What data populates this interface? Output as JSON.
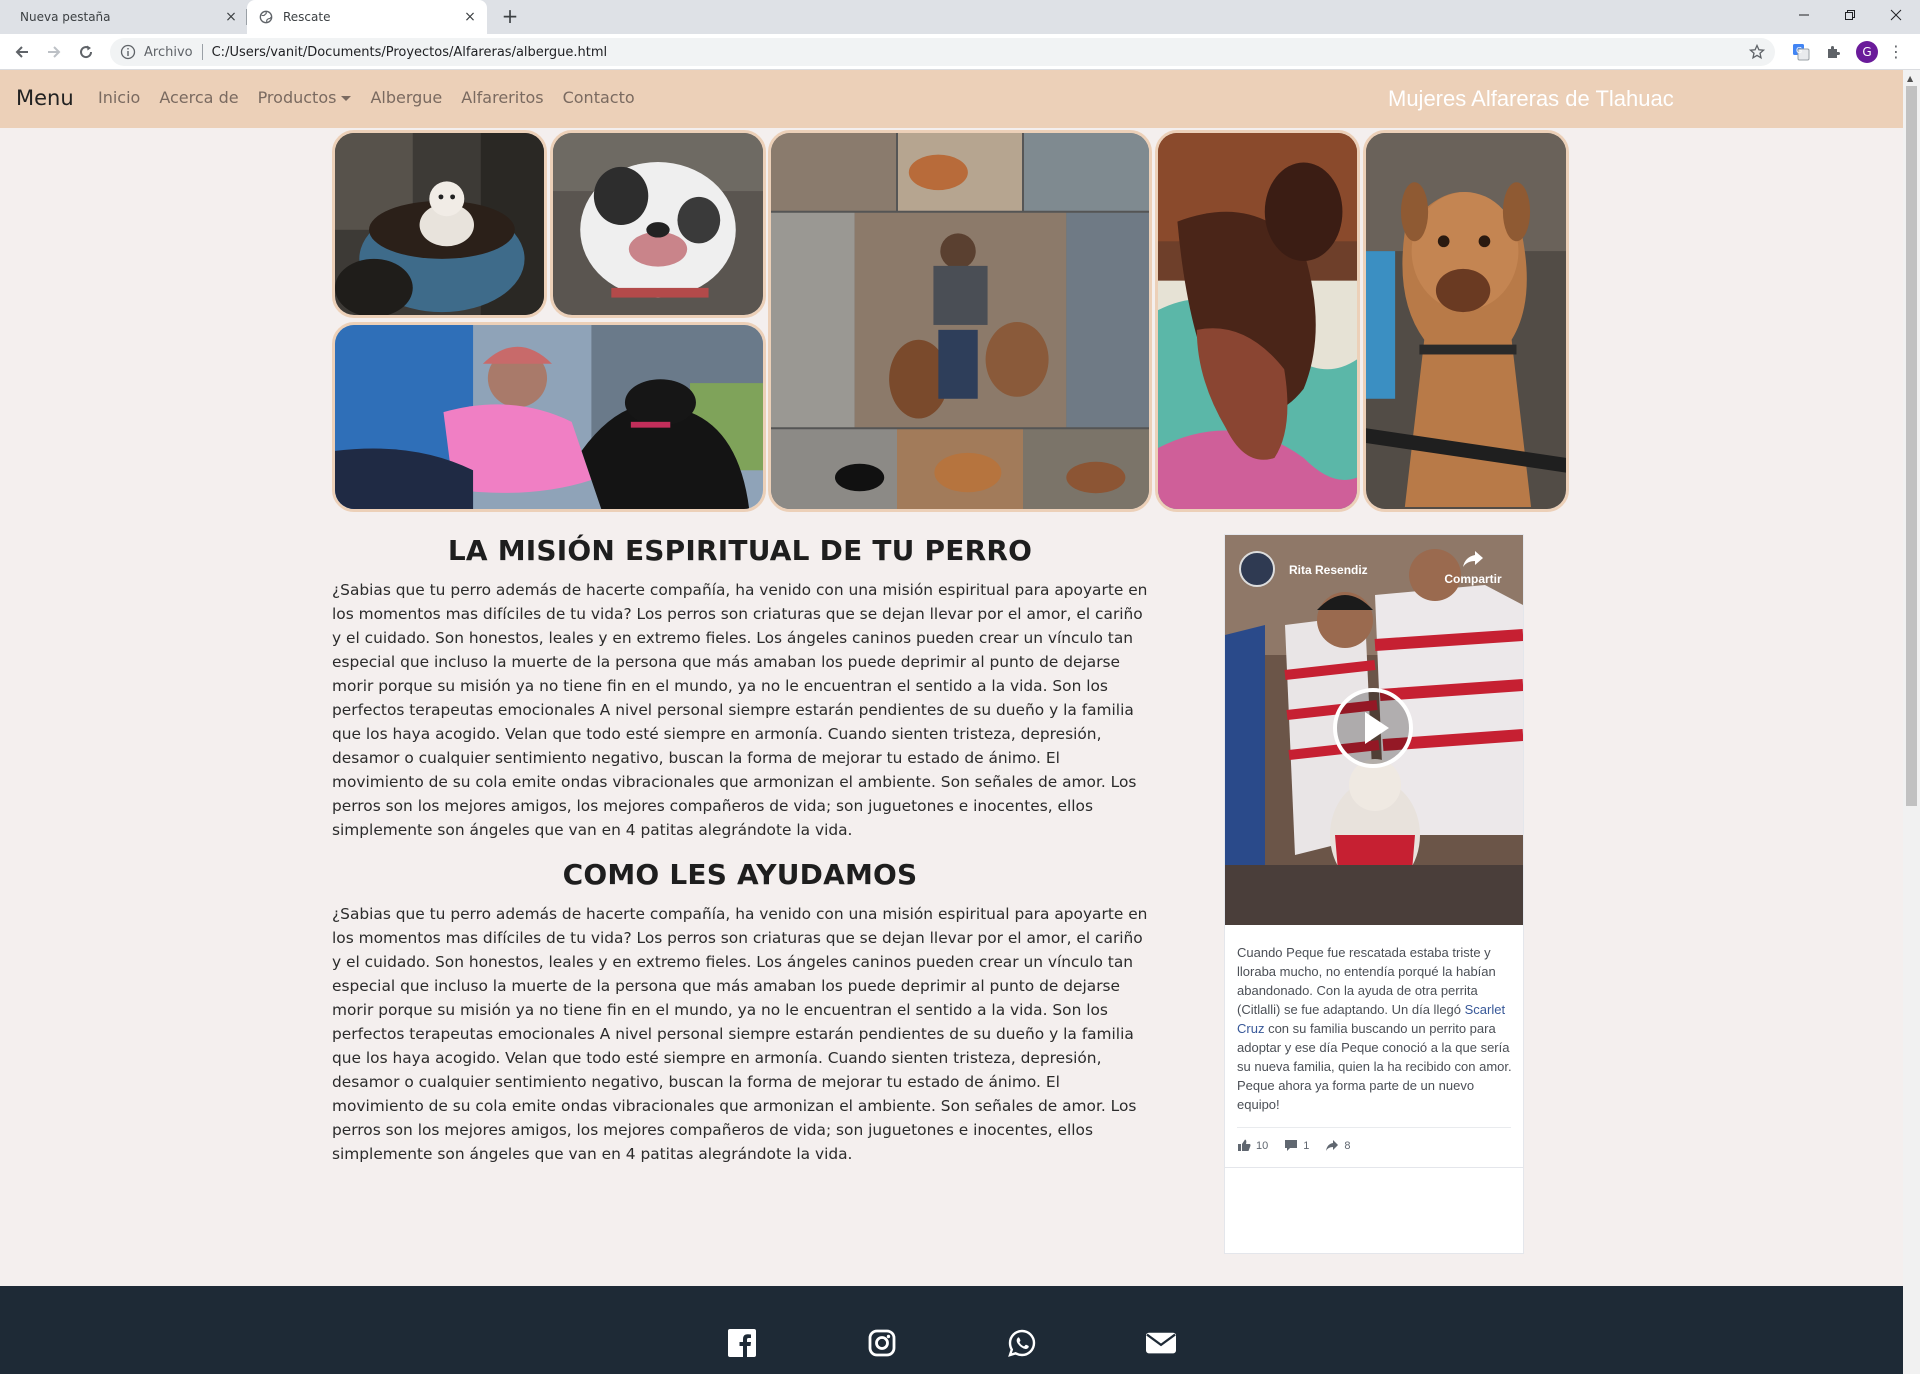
{
  "browser": {
    "tabs": [
      {
        "title": "Nueva pestaña",
        "active": false
      },
      {
        "title": "Rescate",
        "active": true
      }
    ],
    "address": {
      "scheme": "Archivo",
      "url": "C:/Users/vanit/Documents/Proyectos/Alfareras/albergue.html"
    },
    "profile_initial": "G"
  },
  "nav": {
    "brand": "Menu",
    "links": [
      "Inicio",
      "Acerca de",
      "Productos",
      "Albergue",
      "Alfareritos",
      "Contacto"
    ],
    "site_title": "Mujeres Alfareras de Tlahuac"
  },
  "sections": [
    {
      "title": "LA MISIÓN ESPIRITUAL DE TU PERRO",
      "text": "¿Sabias que tu perro además de hacerte compañía, ha venido con una misión espiritual para apoyarte en los momentos mas difíciles de tu vida? Los perros son criaturas que se dejan llevar por el amor, el cariño y el cuidado. Son honestos, leales y en extremo fieles. Los ángeles caninos pueden crear un vínculo tan especial que incluso la muerte de la persona que más amaban los puede deprimir al punto de dejarse morir porque su misión ya no tiene fin en el mundo, ya no le encuentran el sentido a la vida. Son los perfectos terapeutas emocionales A nivel personal siempre estarán pendientes de su dueño y la familia que los haya acogido. Velan que todo esté siempre en armonía. Cuando sienten tristeza, depresión, desamor o cualquier sentimiento negativo, buscan la forma de mejorar tu estado de ánimo. El movimiento de su cola emite ondas vibracionales que armonizan el ambiente. Son señales de amor. Los perros son los mejores amigos, los mejores compañeros de vida; son juguetones e inocentes, ellos simplemente son ángeles que van en 4 patitas alegrándote la vida."
    },
    {
      "title": "COMO LES AYUDAMOS",
      "text": "¿Sabias que tu perro además de hacerte compañía, ha venido con una misión espiritual para apoyarte en los momentos mas difíciles de tu vida? Los perros son criaturas que se dejan llevar por el amor, el cariño y el cuidado. Son honestos, leales y en extremo fieles. Los ángeles caninos pueden crear un vínculo tan especial que incluso la muerte de la persona que más amaban los puede deprimir al punto de dejarse morir porque su misión ya no tiene fin en el mundo, ya no le encuentran el sentido a la vida. Son los perfectos terapeutas emocionales A nivel personal siempre estarán pendientes de su dueño y la familia que los haya acogido. Velan que todo esté siempre en armonía. Cuando sienten tristeza, depresión, desamor o cualquier sentimiento negativo, buscan la forma de mejorar tu estado de ánimo. El movimiento de su cola emite ondas vibracionales que armonizan el ambiente. Son señales de amor. Los perros son los mejores amigos, los mejores compañeros de vida; son juguetones e inocentes, ellos simplemente son ángeles que van en 4 patitas alegrándote la vida."
    }
  ],
  "fb_post": {
    "author": "Rita Resendiz",
    "share_label": "Compartir",
    "text_before": "Cuando Peque fue rescatada estaba triste y lloraba mucho, no entendía porqué la habían abandonado. Con la ayuda de otra perrita (Citlalli) se fue adaptando. Un día llegó ",
    "mention": "Scarlet Cruz",
    "text_after": " con su familia buscando un perrito para adoptar y ese día Peque conoció a la que sería su nueva familia, quien la ha recibido con amor. Peque ahora ya forma parte de un nuevo equipo!",
    "likes": "10",
    "comments": "1",
    "shares": "8"
  },
  "footer": {
    "icons": [
      "facebook-icon",
      "instagram-icon",
      "whatsapp-icon",
      "email-icon"
    ]
  },
  "colors": {
    "navbar": "#ecd0b8",
    "page_bg": "#f4efee",
    "footer": "#1e2a36"
  }
}
